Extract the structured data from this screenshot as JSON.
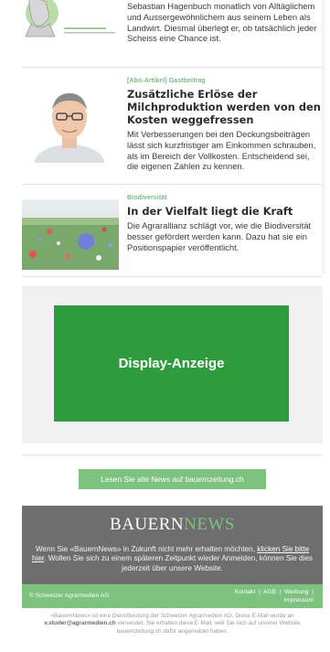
{
  "articles": [
    {
      "kicker": "",
      "headline": "",
      "teaser": "Sebastian Hagenbuch monatlich von Alltäglichem und Aussergewöhnlichem aus seinem Leben als Landwirt. Diesmal überlegt er, ob tatsächlich jeder Scheiss eine Chance ist."
    },
    {
      "kicker": "[Abo-Artikel] Gastbeitrag",
      "headline": "Zusätzliche Erlöse der Milchproduktion werden von den Kosten weggefressen",
      "teaser": "Mit Verbesserungen bei den Deckungsbeiträgen lässt sich kurzfristiger am Einkommen schrauben, als im Bereich der Vollkosten. Entscheidend sei, die eigenen Zahlen zu kennen."
    },
    {
      "kicker": "Biodiversität",
      "headline": "In der Vielfalt liegt die Kraft",
      "teaser": "Die Agrarallianz schlägt vor, wie die Biodiversität besser gefördert werden kann. Dazu hat sie ein Positionspapier veröffentlicht."
    }
  ],
  "ad": {
    "label": "Display-Anzeige"
  },
  "cta": {
    "label": "Lesen Sie alle News auf bauernzeitung.ch"
  },
  "footer": {
    "brand_part1": "BAUERN",
    "brand_part2": "NEWS",
    "msg_before_link": "Wenn Sie «BauernNews» in Zukunft nicht mehr erhalten möchten, ",
    "unsubscribe_link": "klicken Sie bitte hier",
    "msg_after_link": ". Wollen Sie sich zu einem späteren Zeitpunkt wieder Anmelden, können Sie dies jederzeit über unsere Website.",
    "copyright": "© Schweizer Agrarmedien AG",
    "link_kontakt": "Kontakt",
    "link_agb": "AGB",
    "link_werbung": "Werbung",
    "link_impressum": "Impressum",
    "legal_part1": "«BauernNews» ist eine Dienstleistung der Schweizer Agrarmedien AG. Diese E-Mail wurde an ",
    "legal_email": "v.studer@agrarmedien.ch",
    "legal_part2": " versendet. Sie erhalten diese E-Mail, weil Sie sich auf unserer Website bauernzeitung.ch dafür angemeldet haben."
  },
  "colors": {
    "accent_green": "#7ec27f",
    "ad_green": "#2e9c3d",
    "footer_gray": "#6e6e6e"
  }
}
